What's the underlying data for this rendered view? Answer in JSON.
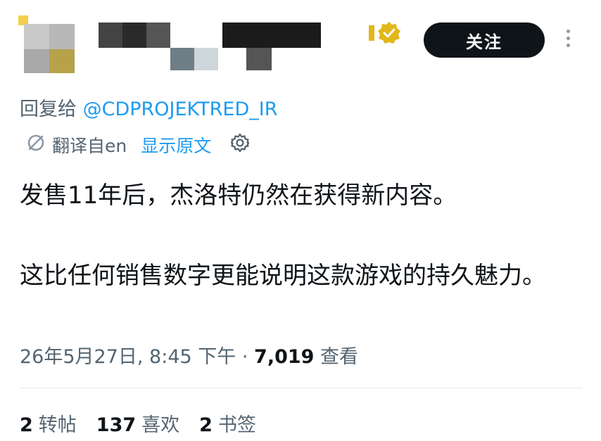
{
  "header": {
    "follow_label": "关注",
    "verified_badge_color": "#e2b719"
  },
  "reply": {
    "prefix": "回复给",
    "mention": "@CDPROJEKTRED_IR"
  },
  "translation": {
    "label": "翻译自en",
    "show_original": "显示原文"
  },
  "tweet": {
    "paragraph1": "发售11年后，杰洛特仍然在获得新内容。",
    "paragraph2": "这比任何销售数字更能说明这款游戏的持久魅力。"
  },
  "meta": {
    "timestamp": "26年5月27日, 8:45 下午 · ",
    "views_count": "7,019",
    "views_label": " 查看"
  },
  "stats": {
    "reposts_count": "2",
    "reposts_label": "转帖",
    "likes_count": "137",
    "likes_label": "喜欢",
    "bookmarks_count": "2",
    "bookmarks_label": "书签"
  }
}
